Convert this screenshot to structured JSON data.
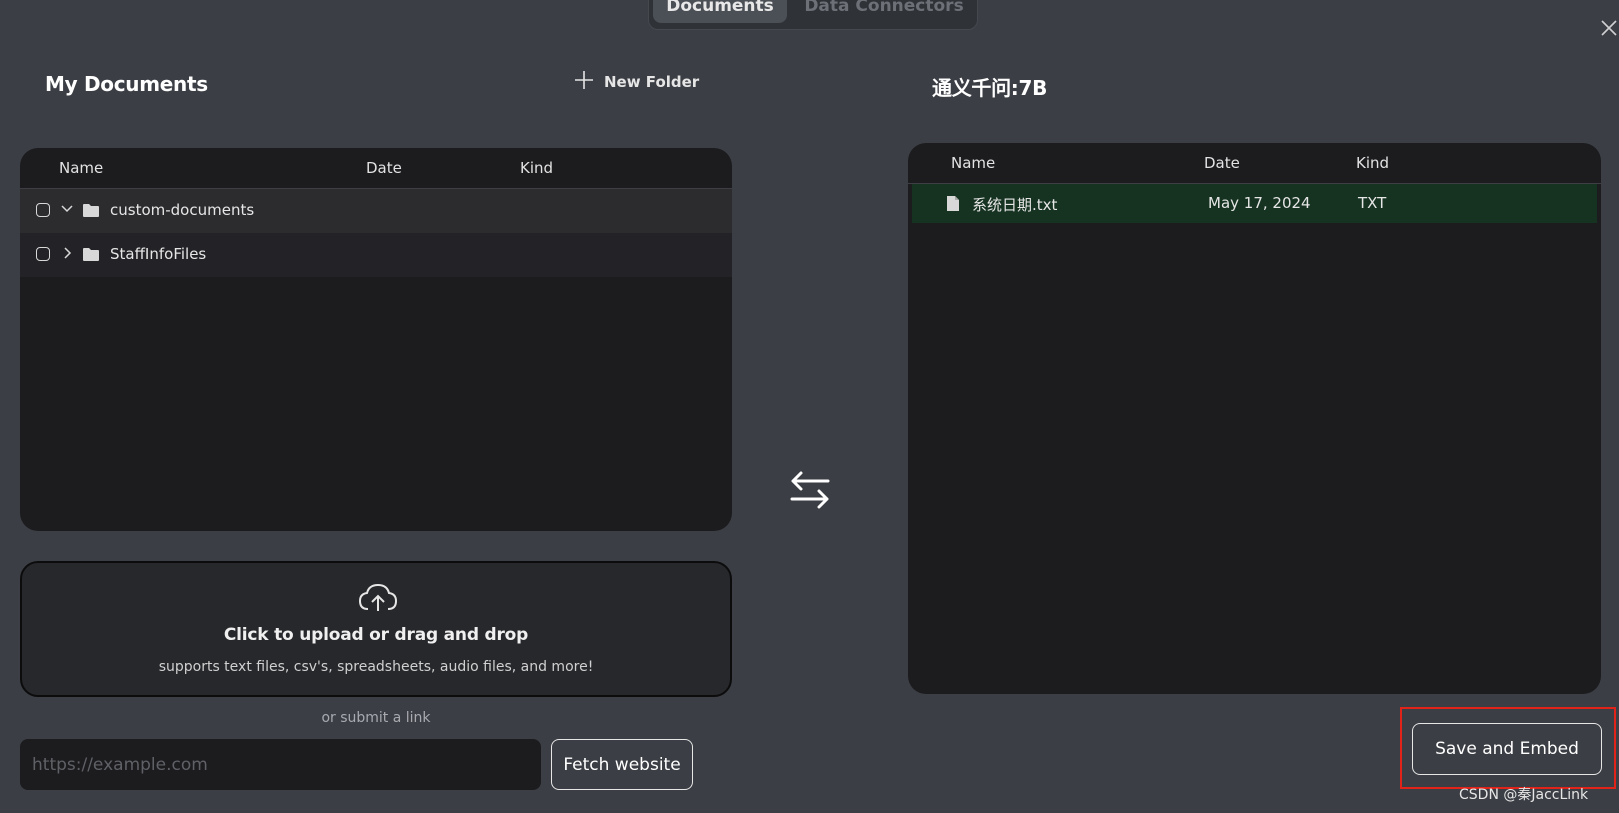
{
  "tabs": [
    {
      "label": "Documents",
      "active": true
    },
    {
      "label": "Data Connectors",
      "active": false
    }
  ],
  "left": {
    "title": "My Documents",
    "new_folder_label": "New Folder",
    "columns": [
      "Name",
      "Date",
      "Kind"
    ],
    "rows": [
      {
        "name": "custom-documents",
        "expanded": true
      },
      {
        "name": "StaffInfoFiles",
        "expanded": false
      }
    ],
    "upload": {
      "title": "Click to upload or drag and drop",
      "subtitle": "supports text files, csv's, spreadsheets, audio files, and more!"
    },
    "or_link": "or submit a link",
    "url_placeholder": "https://example.com",
    "fetch_label": "Fetch website"
  },
  "right": {
    "title": "通义千问:7B",
    "columns": [
      "Name",
      "Date",
      "Kind"
    ],
    "rows": [
      {
        "name": "系统日期.txt",
        "date": "May 17, 2024",
        "kind": "TXT"
      }
    ],
    "save_label": "Save and Embed"
  },
  "watermark": "CSDN @秦JaccLink",
  "colors": {
    "background": "#3b3e44",
    "panel": "#1c1c1f",
    "selected_row": "#163322",
    "highlight_box": "#e2231a"
  }
}
